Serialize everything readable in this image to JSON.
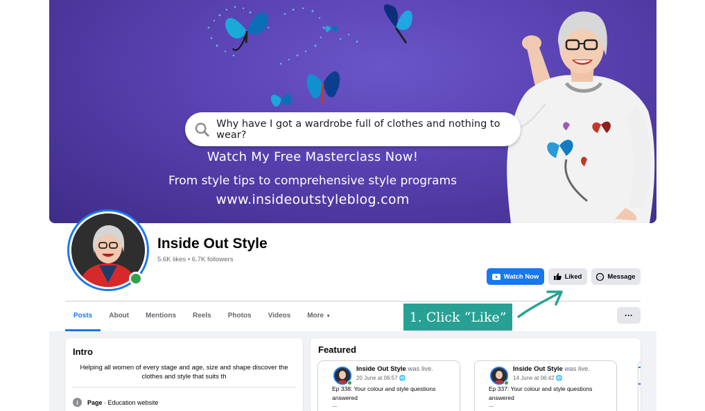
{
  "cover": {
    "search_query": "Why have I got a wardrobe full of clothes and nothing to wear?",
    "line1": "Watch My Free Masterclass Now!",
    "line2": "From style tips to comprehensive style programs",
    "line3": "www.insideoutstyleblog.com",
    "bg_color": "#5a43b3"
  },
  "profile": {
    "name": "Inside Out Style",
    "stats": "5.6K likes • 6.7K followers",
    "online": true
  },
  "actions": {
    "watch_label": "Watch Now",
    "liked_label": "Liked",
    "message_label": "Message",
    "more_label": "···"
  },
  "tabs": [
    {
      "label": "Posts",
      "active": true
    },
    {
      "label": "About"
    },
    {
      "label": "Mentions"
    },
    {
      "label": "Reels"
    },
    {
      "label": "Photos"
    },
    {
      "label": "Videos"
    },
    {
      "label": "More"
    }
  ],
  "annotation": {
    "text": "1. Click “Like”",
    "color": "#27a193"
  },
  "intro": {
    "title": "Intro",
    "text": "Helping all women of every stage and age, size and shape discover the clothes and style that suits th",
    "info_label": "Page",
    "info_value": " · Education website"
  },
  "featured": {
    "title": "Featured",
    "items": [
      {
        "name": "Inside Out Style",
        "suffix": " was live.",
        "date": "20 June at 06:57",
        "desc": "Ep 338: Your colour and style questions answered",
        "more": "..."
      },
      {
        "name": "Inside Out Style",
        "suffix": " was live.",
        "date": "14 June at 06:42",
        "desc": "Ep 337: Your colour and style questions answered",
        "more": "..."
      }
    ]
  },
  "colors": {
    "accent": "#1877f2",
    "online": "#31a24c",
    "secondary_btn": "#e4e6eb"
  }
}
